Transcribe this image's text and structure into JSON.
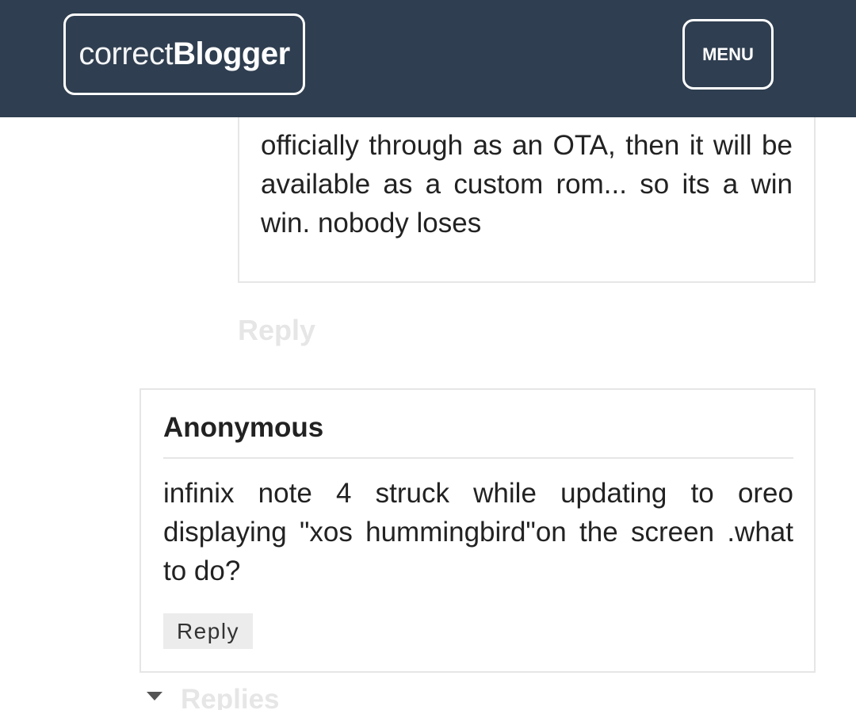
{
  "header": {
    "logo_light": "correct",
    "logo_bold": "Blogger",
    "menu_label": "MENU",
    "background": "#2f3e50"
  },
  "comments": [
    {
      "text": "officially through as an OTA, then it will be available as a custom rom... so its a win win. nobody loses",
      "reply_label": "Reply"
    },
    {
      "author": "Anonymous",
      "text": "infinix note 4 struck while updating to oreo displaying \"xos hummingbird\"on the screen .what to do?",
      "reply_label": "Reply",
      "replies_label": "Replies"
    }
  ],
  "icons": {
    "replies_toggle": "triangle-down-icon"
  }
}
